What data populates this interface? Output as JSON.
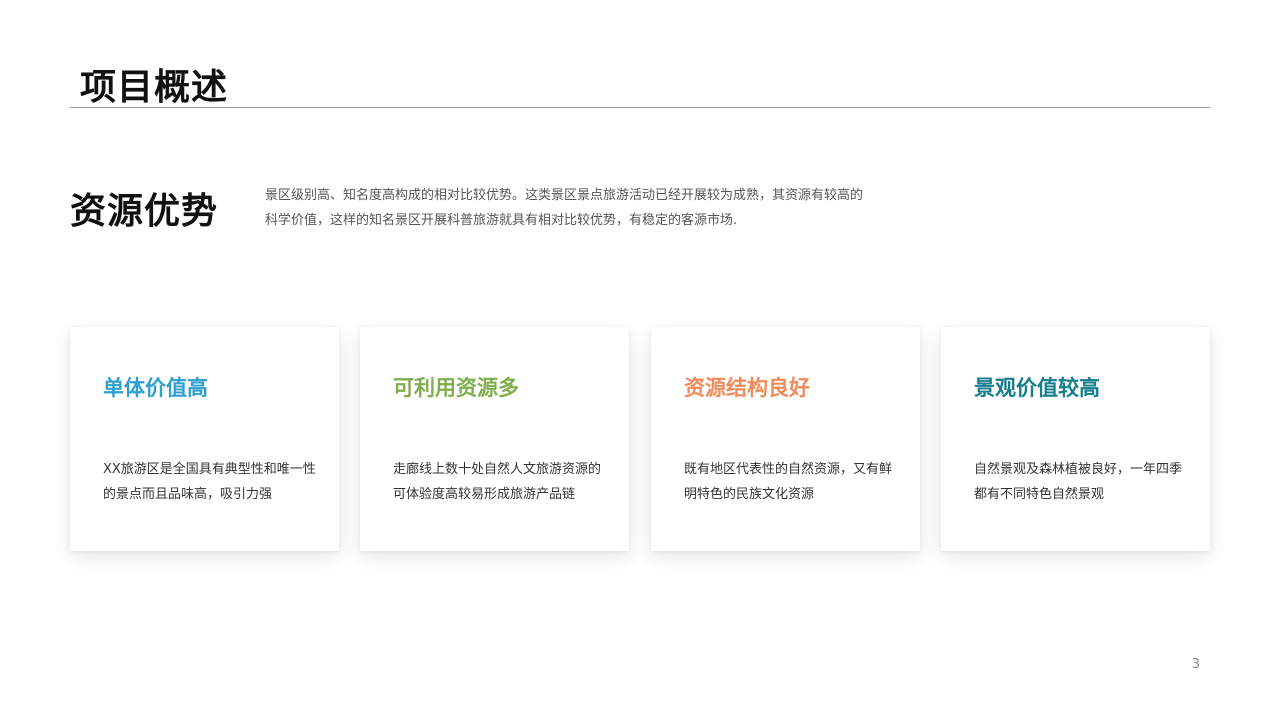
{
  "slide": {
    "title": "项目概述",
    "page_number": "3"
  },
  "section": {
    "heading": "资源优势",
    "description": "景区级别高、知名度高构成的相对比较优势。这类景区景点旅游活动已经开展较为成熟，其资源有较高的科学价值，这样的知名景区开展科普旅游就具有相对比较优势，有稳定的客源市场."
  },
  "cards": [
    {
      "title": "单体价值高",
      "text": "XX旅游区是全国具有典型性和唯一性的景点而且品味高，吸引力强",
      "color": "#2e9fcf"
    },
    {
      "title": "可利用资源多",
      "text": "走廊线上数十处自然人文旅游资源的可体验度高较易形成旅游产品链",
      "color": "#7fae4d"
    },
    {
      "title": "资源结构良好",
      "text": "既有地区代表性的自然资源，又有鲜明特色的民族文化资源",
      "color": "#f28b5c"
    },
    {
      "title": "景观价值较高",
      "text": "自然景观及森林植被良好，一年四季都有不同特色自然景观",
      "color": "#157d8c"
    }
  ]
}
